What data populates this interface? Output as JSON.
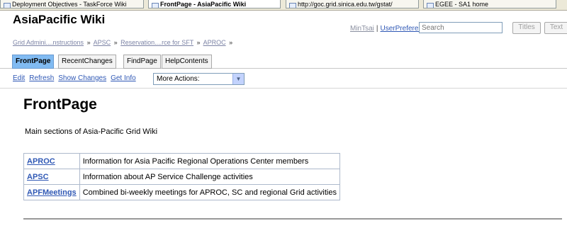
{
  "browser_tabs": [
    {
      "label": "Deployment Objectives - TaskForce Wiki"
    },
    {
      "label": "FrontPage - AsiaPacific Wiki",
      "active": true
    },
    {
      "label": "http://goc.grid.sinica.edu.tw/gstat/"
    },
    {
      "label": "EGEE - SA1 home"
    }
  ],
  "header": {
    "site_title": "AsiaPacific Wiki",
    "user_name": "MinTsai",
    "separator": "|",
    "user_prefs": "UserPreferences",
    "search_placeholder": "Search",
    "titles_button": "Titles",
    "text_button": "Text"
  },
  "trail": {
    "items": [
      "Grid Admini....nstructions",
      "APSC",
      "Reservation....rce for SFT",
      "APROC"
    ],
    "separator": "»"
  },
  "navi_tabs": [
    {
      "label": "FrontPage",
      "current": true
    },
    {
      "label": "RecentChanges"
    },
    {
      "label": "FindPage"
    },
    {
      "label": "HelpContents"
    }
  ],
  "editbar": {
    "links": [
      "Edit",
      "Refresh",
      "Show Changes",
      "Get Info"
    ],
    "more_actions": "More Actions:"
  },
  "content": {
    "heading": "FrontPage",
    "intro": "Main sections of Asia-Pacific Grid Wiki",
    "sections": [
      {
        "link": "APROC",
        "description": "Information for Asia Pacific Regional Operations Center members"
      },
      {
        "link": "APSC",
        "description": "Information about AP Service Challenge activities"
      },
      {
        "link": "APFMeetings",
        "description": "Combined bi-weekly meetings for APROC, SC and regional Grid activities"
      }
    ]
  },
  "colors": {
    "link": "#2f58b5",
    "current_tab": "#81bbf2",
    "table_border": "#adb9cc"
  }
}
